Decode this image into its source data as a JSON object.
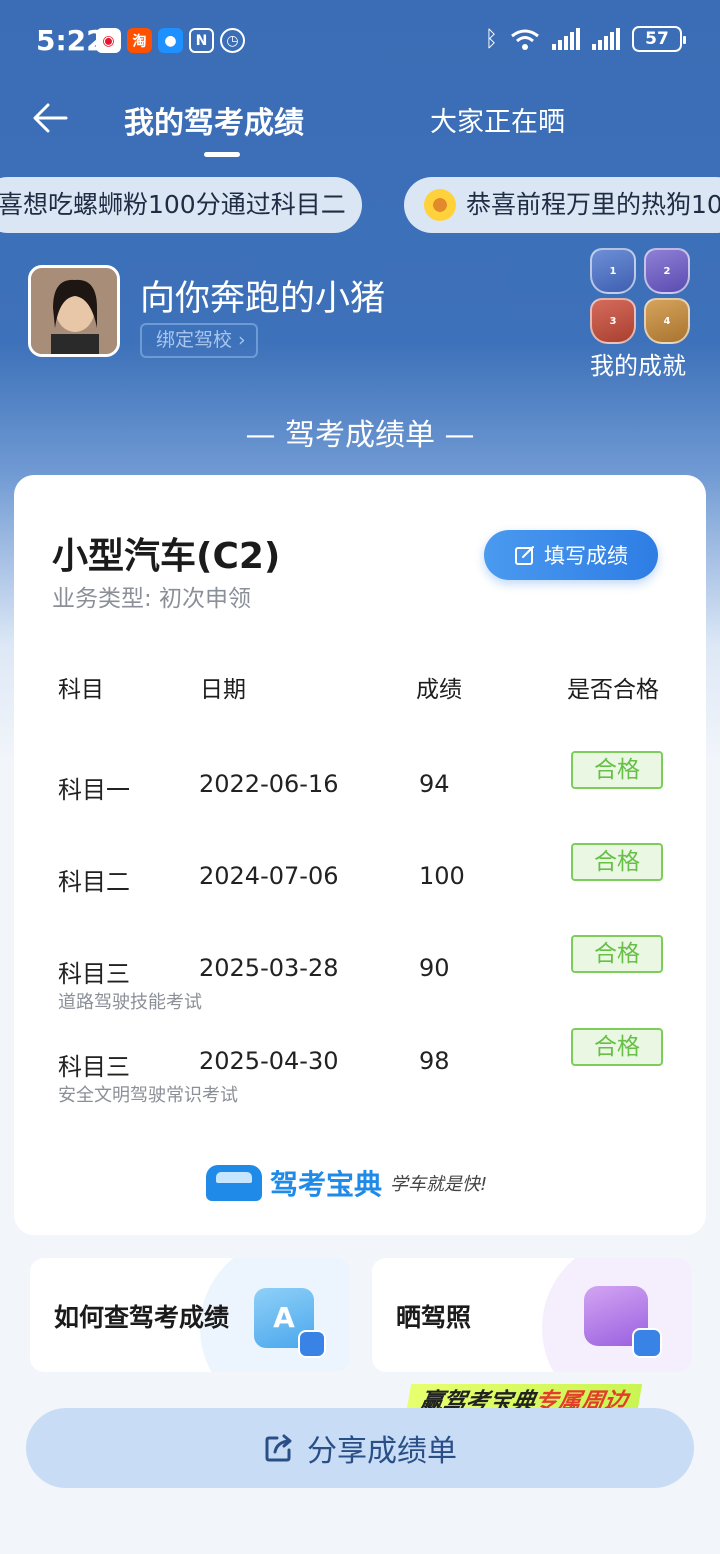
{
  "status_bar": {
    "time": "5:22",
    "battery": "57"
  },
  "nav": {
    "tab_active": "我的驾考成绩",
    "tab_other": "大家正在晒"
  },
  "ticker": {
    "item1": "喜想吃螺蛳粉100分通过科目二",
    "item2": "恭喜前程万里的热狗10"
  },
  "profile": {
    "username": "向你奔跑的小猪",
    "bind_school": "绑定驾校",
    "achievements_label": "我的成就"
  },
  "sheet_title": "— 驾考成绩单 —",
  "card": {
    "license": "小型汽车(C2)",
    "business_type": "业务类型: 初次申领",
    "fill_button": "填写成绩",
    "headers": {
      "subject": "科目",
      "date": "日期",
      "score": "成绩",
      "pass": "是否合格"
    },
    "rows": [
      {
        "subject": "科目一",
        "date": "2022-06-16",
        "score": "94",
        "pass": "合格",
        "note": ""
      },
      {
        "subject": "科目二",
        "date": "2024-07-06",
        "score": "100",
        "pass": "合格",
        "note": ""
      },
      {
        "subject": "科目三",
        "date": "2025-03-28",
        "score": "90",
        "pass": "合格",
        "note": "道路驾驶技能考试"
      },
      {
        "subject": "科目三",
        "date": "2025-04-30",
        "score": "98",
        "pass": "合格",
        "note": "安全文明驾驶常识考试"
      }
    ],
    "brand": "驾考宝典",
    "slogan": "学车就是快!"
  },
  "quick": {
    "check_scores": "如何查驾考成绩",
    "show_license": "晒驾照"
  },
  "promo": {
    "prefix": "赢驾考宝典",
    "highlight": "专属周边"
  },
  "share_button": "分享成绩单",
  "colors": {
    "primary": "#3b6db6",
    "accent": "#2e7de4",
    "pass_green": "#67c046"
  }
}
